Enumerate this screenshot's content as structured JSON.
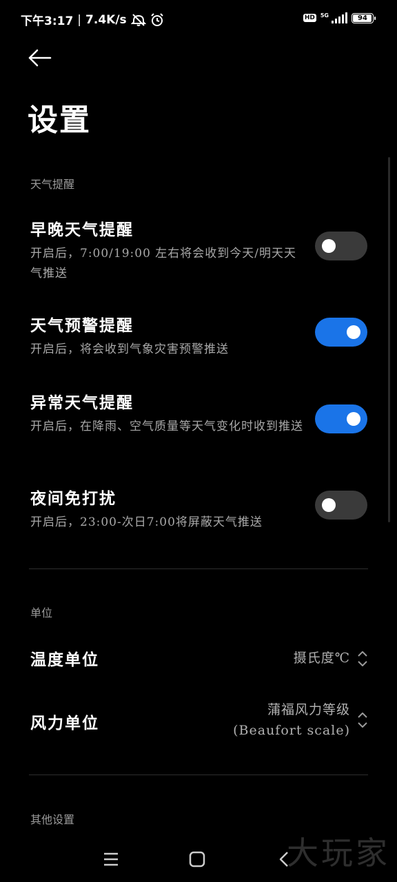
{
  "status_bar": {
    "time": "下午3:17",
    "separator": "|",
    "speed": "7.4K/s",
    "hd_label": "HD",
    "network": "5G",
    "battery": "94"
  },
  "header": {
    "title": "设置"
  },
  "sections": {
    "weather_reminder": {
      "label": "天气提醒",
      "items": [
        {
          "title": "早晚天气提醒",
          "desc": "开启后，7:00/19:00 左右将会收到今天/明天天气推送",
          "enabled": false
        },
        {
          "title": "天气预警提醒",
          "desc": "开启后，将会收到气象灾害预警推送",
          "enabled": true
        },
        {
          "title": "异常天气提醒",
          "desc": "开启后，在降雨、空气质量等天气变化时收到推送",
          "enabled": true
        },
        {
          "title": "夜间免打扰",
          "desc": "开启后，23:00-次日7:00将屏蔽天气推送",
          "enabled": false
        }
      ]
    },
    "units": {
      "label": "单位",
      "temperature": {
        "title": "温度单位",
        "value": "摄氏度℃"
      },
      "wind": {
        "title": "风力单位",
        "value_line1": "蒲福风力等级",
        "value_line2": "(Beaufort scale)"
      }
    },
    "other": {
      "label": "其他设置"
    }
  },
  "watermark": "大玩家",
  "colors": {
    "background": "#000000",
    "accent": "#1a74e8",
    "toggle_off": "#3a3a3a",
    "secondary_text": "#a8a8a8"
  }
}
